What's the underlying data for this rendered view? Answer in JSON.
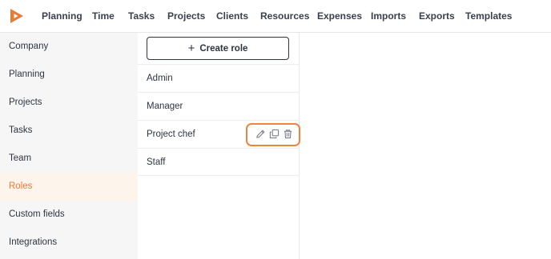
{
  "app": {
    "logo_icon": "brand-logo-icon",
    "brand_color": "#ea7a34"
  },
  "nav": {
    "items": [
      "Planning",
      "Time",
      "Tasks",
      "Projects",
      "Clients",
      "Resources",
      "Expenses",
      "Imports",
      "Exports",
      "Templates"
    ]
  },
  "sidebar": {
    "items": [
      {
        "label": "Company"
      },
      {
        "label": "Planning"
      },
      {
        "label": "Projects"
      },
      {
        "label": "Tasks"
      },
      {
        "label": "Team"
      },
      {
        "label": "Roles",
        "active": true
      },
      {
        "label": "Custom fields"
      },
      {
        "label": "Integrations"
      }
    ]
  },
  "roles": {
    "create_label": "Create role",
    "create_icon": "plus-icon",
    "items": [
      {
        "name": "Admin"
      },
      {
        "name": "Manager"
      },
      {
        "name": "Project chef",
        "hovered": true
      },
      {
        "name": "Staff"
      }
    ],
    "actions": [
      "edit-icon",
      "duplicate-icon",
      "delete-icon"
    ],
    "highlight_color": "#ef8341"
  }
}
